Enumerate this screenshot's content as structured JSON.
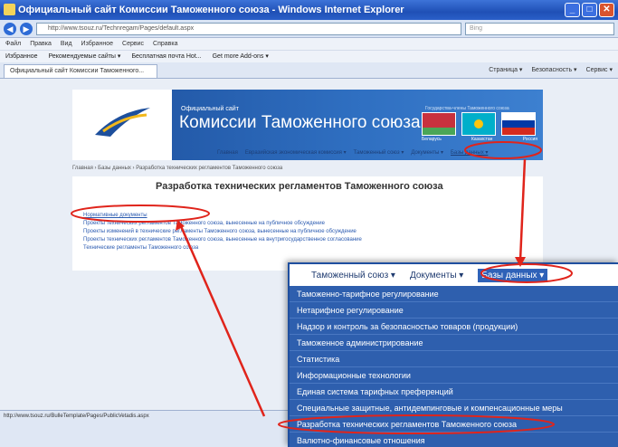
{
  "window": {
    "title": "Официальный сайт Комиссии Таможенного союза - Windows Internet Explorer"
  },
  "browser": {
    "url": "http://www.tsouz.ru/Technregam/Pages/default.aspx",
    "search_placeholder": "Bing",
    "menu": [
      "Файл",
      "Правка",
      "Вид",
      "Избранное",
      "Сервис",
      "Справка"
    ],
    "favorites": [
      "Избранное",
      "Рекомендуемые сайты ▾",
      "Бесплатная почта Hot...",
      "Get more Add-ons ▾"
    ],
    "tab_label": "Официальный сайт Комиссии Таможенного...",
    "commands": [
      "Страница ▾",
      "Безопасность ▾",
      "Сервис ▾"
    ],
    "status_text": "http://www.tsouz.ru/BulleTemplate/Pages/PublicVetadis.aspx"
  },
  "site": {
    "subtitle": "Официальный сайт",
    "title": "Комиссии Таможенного союза",
    "flag_caption": "Государства-члены Таможенного союза",
    "flags": [
      "Беларусь",
      "Казахстан",
      "Россия"
    ],
    "nav": [
      "Главная",
      "Евразийская экономическая комиссия ▾",
      "Таможенный союз ▾",
      "Документы ▾",
      "Базы данных ▾"
    ],
    "breadcrumb": "Главная › Базы данных › Разработка технических регламентов Таможенного союза",
    "heading": "Разработка технических регламентов Таможенного союза",
    "links": [
      "Нормативные документы",
      "Проекты технических регламентов Таможенного союза, вынесенные на публичное обсуждение",
      "Проекты изменений в технические регламенты Таможенного союза, вынесенные на публичное обсуждение",
      "Проекты технических регламентов Таможенного союза, вынесенные на внутригосударственное согласование",
      "Технические регламенты Таможенного союза"
    ]
  },
  "zoom": {
    "nav": [
      "Таможенный союз ▾",
      "Документы ▾",
      "Базы данных ▾"
    ],
    "items": [
      "Таможенно-тарифное регулирование",
      "Нетарифное регулирование",
      "Надзор и контроль за безопасностью товаров (продукции)",
      "Таможенное администрирование",
      "Статистика",
      "Информационные технологии",
      "Единая система тарифных преференций",
      "Специальные защитные, антидемпинговые и компенсационные меры",
      "Разработка технических регламентов Таможенного союза",
      "Валютно-финансовые отношения"
    ]
  },
  "colors": {
    "annotation": "#e0241b",
    "menu_bg": "#2e5fae",
    "header_bg": "#1d4f9c"
  }
}
